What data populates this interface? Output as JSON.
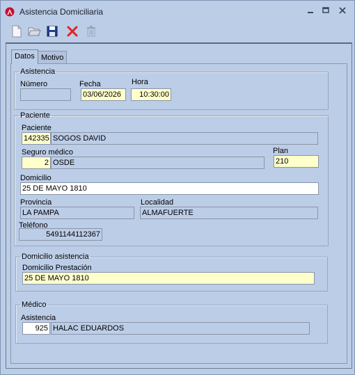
{
  "window": {
    "title": "Asistencia Domiciliaria"
  },
  "titlebar_icons": {
    "app": "app-logo-icon",
    "minimize": "minimize-icon",
    "restore": "restore-icon",
    "close": "close-icon"
  },
  "toolbar": {
    "new": "new-document-icon",
    "open": "open-folder-icon",
    "save": "save-disk-icon",
    "delete": "delete-x-icon",
    "trash": "trash-icon"
  },
  "tabs": [
    {
      "label": "Datos"
    },
    {
      "label": "Motivo"
    }
  ],
  "asistencia": {
    "legend": "Asistencia",
    "numero_label": "Número",
    "numero_value": "",
    "fecha_label": "Fecha",
    "fecha_value": "03/06/2026",
    "hora_label": "Hora",
    "hora_value": "10:30:00"
  },
  "paciente": {
    "legend": "Paciente",
    "paciente_label": "Paciente",
    "paciente_id": "142335",
    "paciente_name": "SOGOS DAVID",
    "seguro_label": "Seguro médico",
    "seguro_id": "2",
    "seguro_name": "OSDE",
    "plan_label": "Plan",
    "plan_value": "210",
    "domicilio_label": "Domicilio",
    "domicilio_value": "25 DE MAYO 1810",
    "provincia_label": "Provincia",
    "provincia_value": "LA PAMPA",
    "localidad_label": "Localidad",
    "localidad_value": "ALMAFUERTE",
    "telefono_label": "Teléfono",
    "telefono_value": "5491144112367"
  },
  "domicilio_asistencia": {
    "legend": "Domicilio asistencia",
    "prestacion_label": "Domicilio Prestación",
    "prestacion_value": "25 DE MAYO 1810"
  },
  "medico": {
    "legend": "Médico",
    "asistencia_label": "Asistencia",
    "medico_id": "925",
    "medico_name": "HALAC EDUARDOS"
  },
  "colors": {
    "background": "#bccde8",
    "input_yellow": "#ffffcc",
    "delete_red": "#e0241c",
    "save_blue": "#1f3f8f"
  }
}
